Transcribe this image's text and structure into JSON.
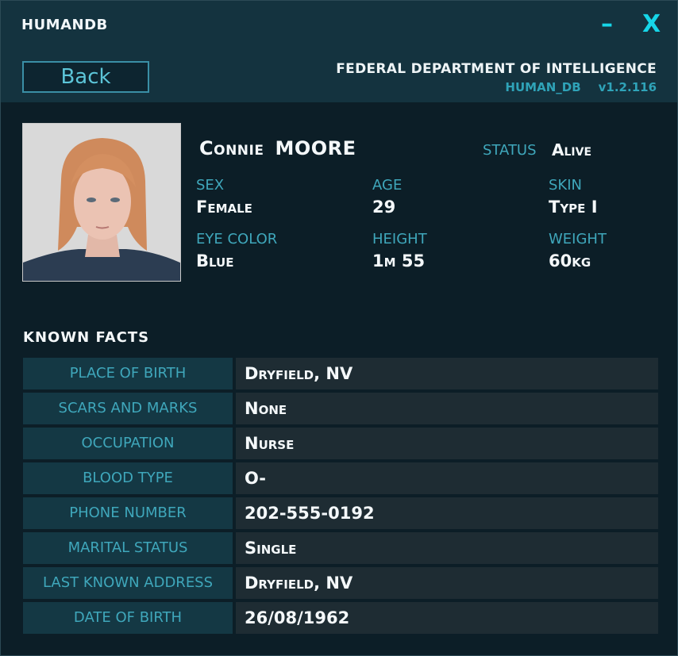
{
  "window": {
    "title": "HUMANDB",
    "minimize_label": "–",
    "close_label": "X"
  },
  "header": {
    "back_label": "Back",
    "organization": "FEDERAL DEPARTMENT OF INTELLIGENCE",
    "db_name": "HUMAN_DB",
    "version": "v1.2.116"
  },
  "profile": {
    "first_name": "Connie",
    "last_name": "MOORE",
    "status_label": "STATUS",
    "status_value": "Alive",
    "attributes": [
      {
        "label": "SEX",
        "value": "Female"
      },
      {
        "label": "AGE",
        "value": "29"
      },
      {
        "label": "SKIN",
        "value": "Type I"
      },
      {
        "label": "EYE COLOR",
        "value": "Blue"
      },
      {
        "label": "HEIGHT",
        "value": "1m 55"
      },
      {
        "label": "WEIGHT",
        "value": "60kg"
      }
    ]
  },
  "facts": {
    "title": "KNOWN  FACTS",
    "rows": [
      {
        "label": "PLACE OF BIRTH",
        "value": "Dryfield, NV"
      },
      {
        "label": "SCARS AND MARKS",
        "value": "None"
      },
      {
        "label": "OCCUPATION",
        "value": "Nurse"
      },
      {
        "label": "BLOOD TYPE",
        "value": "O-"
      },
      {
        "label": "PHONE NUMBER",
        "value": "202-555-0192"
      },
      {
        "label": "MARITAL STATUS",
        "value": "Single"
      },
      {
        "label": "LAST KNOWN ADDRESS",
        "value": "Dryfield, NV"
      },
      {
        "label": "DATE OF BIRTH",
        "value": "26/08/1962"
      }
    ]
  },
  "colors": {
    "accent": "#16d6e8",
    "label": "#3fa7bb",
    "text": "#f4f8fa"
  }
}
